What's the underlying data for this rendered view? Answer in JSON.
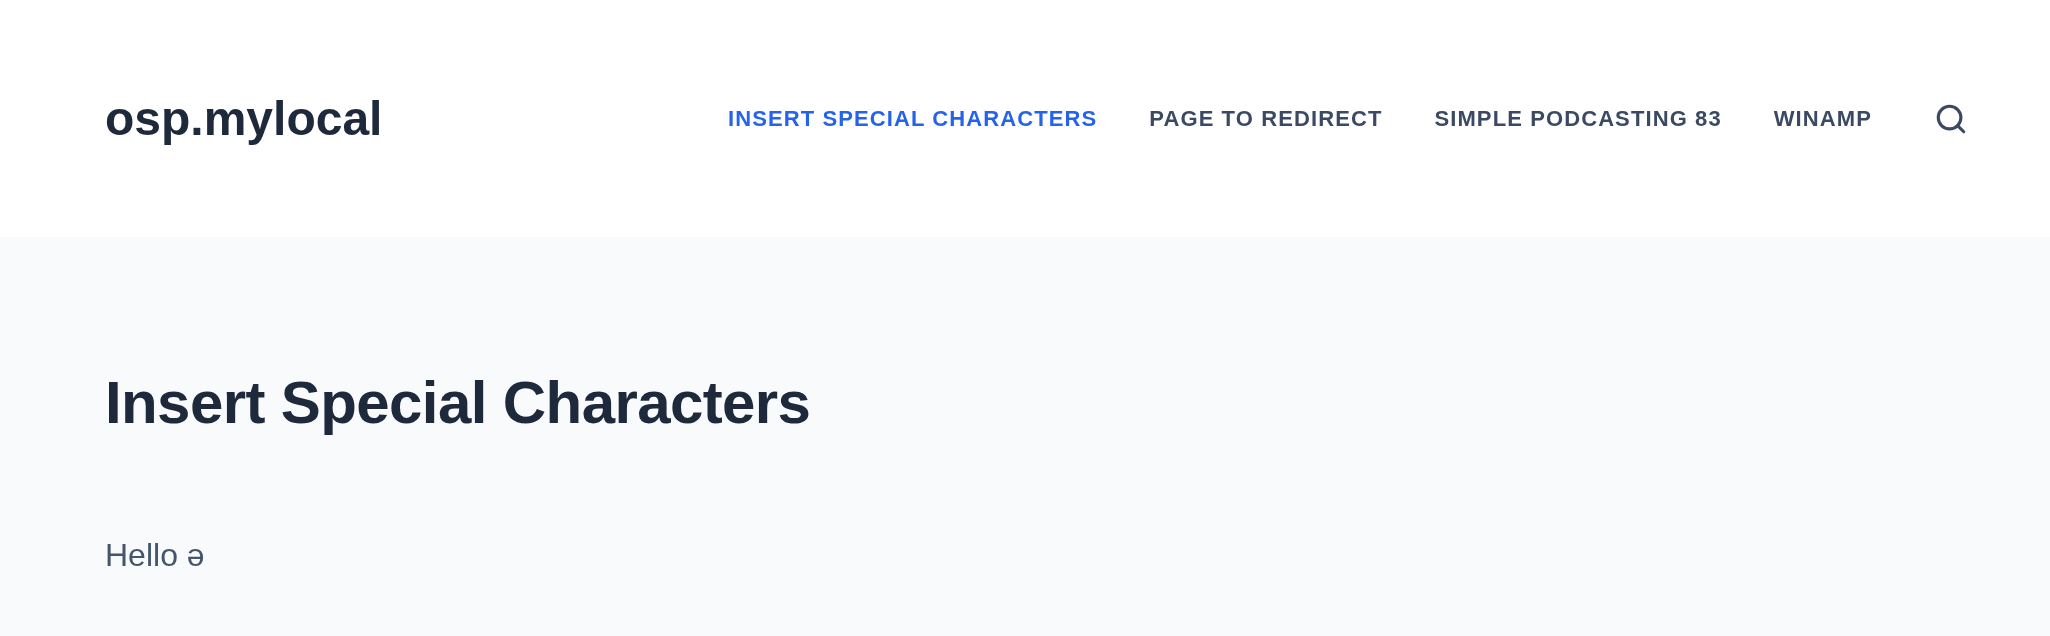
{
  "site": {
    "title": "osp.mylocal"
  },
  "nav": {
    "items": [
      {
        "label": "INSERT SPECIAL CHARACTERS",
        "selected": true
      },
      {
        "label": "PAGE TO REDIRECT",
        "selected": false
      },
      {
        "label": "SIMPLE PODCASTING 83",
        "selected": false
      },
      {
        "label": "WINAMP",
        "selected": false
      }
    ]
  },
  "page": {
    "heading": "Insert Special Characters",
    "body": "Hello ə"
  }
}
